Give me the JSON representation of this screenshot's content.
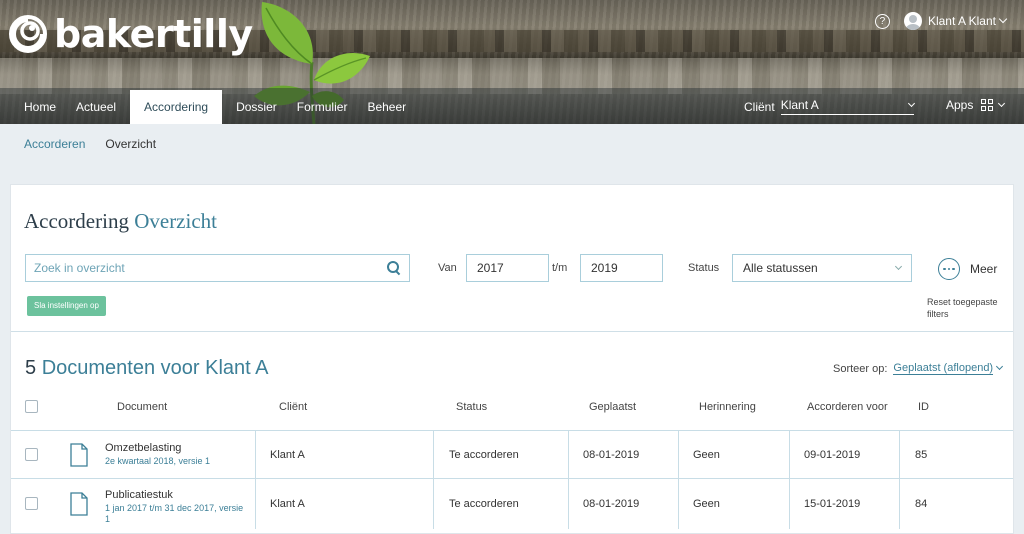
{
  "brand": {
    "name": "bakertilly",
    "accent": "#3c7f97",
    "green": "#6cc29d"
  },
  "header": {
    "help_icon": "?",
    "user_name": "Klant A Klant",
    "nav": [
      "Home",
      "Actueel",
      "Accordering",
      "Dossier",
      "Formulier",
      "Beheer"
    ],
    "active_nav": "Accordering",
    "client_label": "Cliënt",
    "client_value": "Klant A",
    "apps_label": "Apps"
  },
  "breadcrumb": {
    "link": "Accorderen",
    "current": "Overzicht"
  },
  "page": {
    "title_main": "Accordering",
    "title_accent": "Overzicht"
  },
  "filters": {
    "search_placeholder": "Zoek in overzicht",
    "van_label": "Van",
    "van_value": "2017",
    "tm_label": "t/m",
    "tm_value": "2019",
    "status_label": "Status",
    "status_value": "Alle statussen",
    "meer_label": "Meer",
    "reset_label": "Reset toegepaste filters",
    "save_button": "Sla instellingen op"
  },
  "results": {
    "count": "5",
    "title": "Documenten voor Klant A",
    "sort_label": "Sorteer op:",
    "sort_value": "Geplaatst (aflopend)"
  },
  "table": {
    "headers": {
      "document": "Document",
      "client": "Cliënt",
      "status": "Status",
      "placed": "Geplaatst",
      "reminder": "Herinnering",
      "approve_before": "Accorderen voor",
      "id": "ID"
    },
    "rows": [
      {
        "title": "Omzetbelasting",
        "subtitle": "2e kwartaal 2018, versie 1",
        "client": "Klant A",
        "status": "Te accorderen",
        "placed": "08-01-2019",
        "reminder": "Geen",
        "approve_before": "09-01-2019",
        "id": "85"
      },
      {
        "title": "Publicatiestuk",
        "subtitle": "1 jan 2017 t/m 31 dec 2017, versie 1",
        "client": "Klant A",
        "status": "Te accorderen",
        "placed": "08-01-2019",
        "reminder": "Geen",
        "approve_before": "15-01-2019",
        "id": "84"
      }
    ]
  }
}
